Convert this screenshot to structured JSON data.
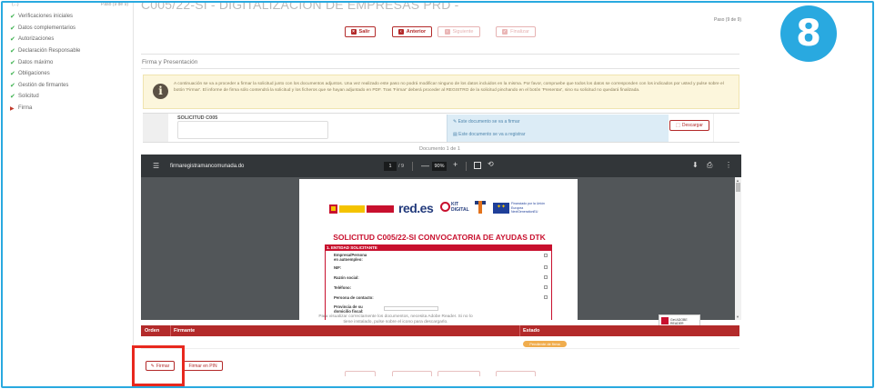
{
  "sidebar": {
    "top_left": "(...)",
    "top_right": "Paso (9 de 9)",
    "items": [
      {
        "label": "Verificaciones iniciales",
        "state": "done"
      },
      {
        "label": "Datos complementarios",
        "state": "done"
      },
      {
        "label": "Autorizaciones",
        "state": "done"
      },
      {
        "label": "Declaración Responsable",
        "state": "done"
      },
      {
        "label": "Datos máximo",
        "state": "done"
      },
      {
        "label": "Obligaciones",
        "state": "done"
      },
      {
        "label": "Gestión de firmantes",
        "state": "done"
      },
      {
        "label": "Solicitud",
        "state": "done"
      },
      {
        "label": "Firma",
        "state": "current"
      }
    ]
  },
  "header": {
    "title": "C005/22-SI - DIGITALIZACIÓN DE EMPRESAS PRD -",
    "step": "Paso (9 de 9)",
    "buttons": {
      "salir": "Salir",
      "anterior": "Anterior",
      "siguiente": "Siguiente",
      "finalizar": "Finalizar"
    }
  },
  "section_title": "Firma y Presentación",
  "warning_text": "A continuación se va a proceder a firmar la solicitud junto con los documentos adjuntos. Una vez realizado este paso no podrá modificar ninguno de los datos incluidos en la misma. Por favor, compruebe que todos los datos se corresponden con los indicados por usted y pulse sobre el botón 'Firmar'. El informe de firma sólo contendrá la solicitud y los ficheros que se hayan adjuntado en PDF. Tras 'Firmar' deberá proceder al REGISTRO de la solicitud pinchando en el botón 'Presentar', sino su solicitud no quedará finalizada.",
  "document": {
    "name": "SOLICITUD C005",
    "info_firmar": "Este documento se va a firmar",
    "info_registrar": "Este documento se va a registrar",
    "download": "Descargar"
  },
  "document_count": "Documento 1 de 1",
  "pdf_viewer": {
    "filename": "firmaregistramancomunada.do",
    "page": "1",
    "page_total": "/ 9",
    "zoom": "90%",
    "zoom_out": "—",
    "zoom_in": "+",
    "doc_title": "SOLICITUD C005/22-SI CONVOCATORIA DE AYUDAS DTK",
    "section": "1. ENTIDAD SOLICITANTE",
    "brand_reddes": "red.es",
    "brand_kit": "KIT DIGITAL",
    "eu_text": "Financiado por la Unión Europea NextGenerationEU",
    "fields": [
      "Empresa/Persona en autoempleo:",
      "NIF:",
      "Razón social:",
      "Teléfono:",
      "Persona de contacto:",
      "Provincia de su domicilio fiscal:"
    ]
  },
  "viewer_hint": "Para visualizar correctamente los documentos, necesita Adobe Reader. Si no lo tiene instalado, pulse sobre el icono para descargarlo.",
  "adobe_label": "Get ADOBE READER",
  "firmantes_table": {
    "headers": [
      "Orden",
      "Firmante",
      "Estado"
    ],
    "status": "Pendiente de firma"
  },
  "actions": {
    "firmar": "Firmar",
    "firmar_pin": "Firmar en PIN"
  },
  "step_badge": "8",
  "colors": {
    "brand_red": "#b32a2a",
    "badge_blue": "#29a9e0",
    "highlight_red": "#e8281e"
  }
}
